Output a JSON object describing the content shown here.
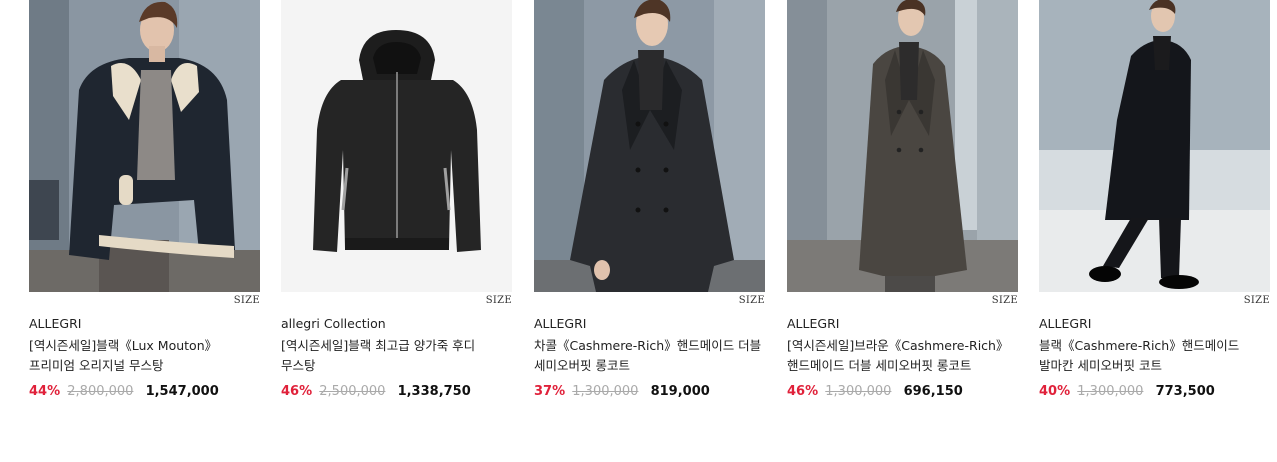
{
  "colors": {
    "discount": "#e0213a",
    "original_price": "#aaaaaa",
    "sale_price": "#111111"
  },
  "products": [
    {
      "brand": "ALLEGRI",
      "title": "[역시즌세일]블랙《Lux Mouton》프리미엄 오리지널 무스탕",
      "size_label": "SIZE",
      "discount": "44%",
      "original_price": "2,800,000",
      "sale_price": "1,547,000"
    },
    {
      "brand": "allegri Collection",
      "title": "[역시즌세일]블랙 최고급 양가죽 후디 무스탕",
      "size_label": "SIZE",
      "discount": "46%",
      "original_price": "2,500,000",
      "sale_price": "1,338,750"
    },
    {
      "brand": "ALLEGRI",
      "title": "차콜《Cashmere-Rich》핸드메이드 더블 세미오버핏 롱코트",
      "size_label": "SIZE",
      "discount": "37%",
      "original_price": "1,300,000",
      "sale_price": "819,000"
    },
    {
      "brand": "ALLEGRI",
      "title": "[역시즌세일]브라운《Cashmere-Rich》핸드메이드 더블 세미오버핏 롱코트",
      "size_label": "SIZE",
      "discount": "46%",
      "original_price": "1,300,000",
      "sale_price": "696,150"
    },
    {
      "brand": "ALLEGRI",
      "title": "블랙《Cashmere-Rich》핸드메이드 발마칸 세미오버핏 코트",
      "size_label": "SIZE",
      "discount": "40%",
      "original_price": "1,300,000",
      "sale_price": "773,500"
    }
  ]
}
